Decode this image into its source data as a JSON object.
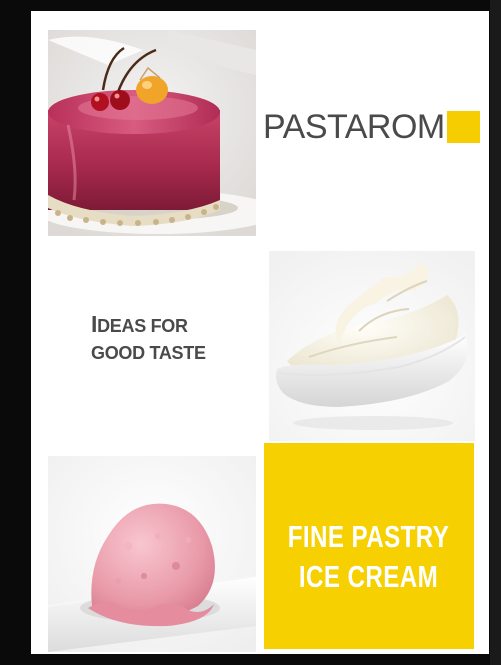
{
  "brand": {
    "name": "PASTAROM",
    "accent_color": "#f6cd00"
  },
  "tagline": {
    "line1_initial": "I",
    "line1_rest": "DEAS FOR",
    "line2": "GOOD TASTE"
  },
  "promo": {
    "line1": "FINE PASTRY",
    "line2": "ICE CREAM",
    "background": "#f6d000"
  },
  "images": {
    "cake": "glazed-raspberry-mousse-cake-photo",
    "cream": "whipped-cream-bowl-photo",
    "ice_cream": "pink-ice-cream-scoop-photo"
  }
}
